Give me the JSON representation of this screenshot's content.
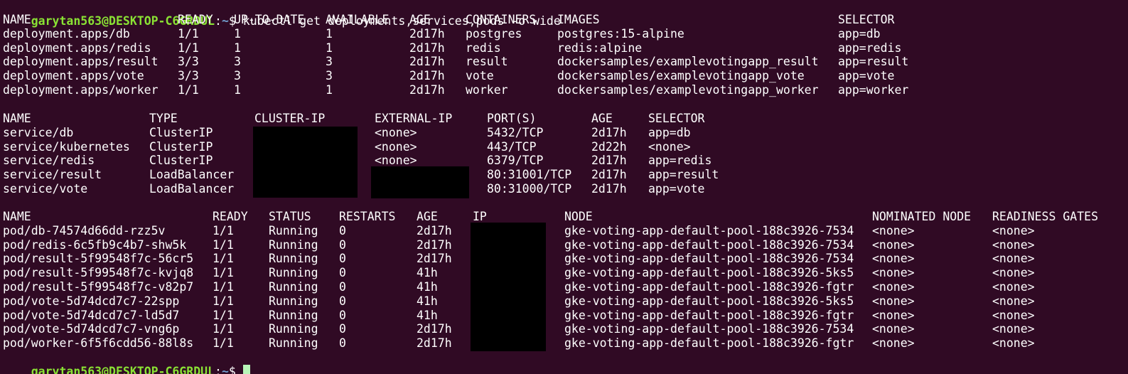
{
  "terminal": {
    "prompt_user": "garytan563@DESKTOP-C6GRDUL",
    "prompt_path": "~",
    "prompt_symbol": "$",
    "command": "kubectl get deployments,services,pods -o wide",
    "colors": {
      "background": "#300a24",
      "text": "#ffffff",
      "prompt_user": "#8ae234",
      "prompt_path": "#729fcf",
      "cursor": "#b8f5b8",
      "redaction": "#000000"
    }
  },
  "deployments": {
    "headers": [
      "NAME",
      "READY",
      "UP-TO-DATE",
      "AVAILABLE",
      "AGE",
      "CONTAINERS",
      "IMAGES",
      "SELECTOR"
    ],
    "rows": [
      [
        "deployment.apps/db",
        "1/1",
        "1",
        "1",
        "2d17h",
        "postgres",
        "postgres:15-alpine",
        "app=db"
      ],
      [
        "deployment.apps/redis",
        "1/1",
        "1",
        "1",
        "2d17h",
        "redis",
        "redis:alpine",
        "app=redis"
      ],
      [
        "deployment.apps/result",
        "3/3",
        "3",
        "3",
        "2d17h",
        "result",
        "dockersamples/examplevotingapp_result",
        "app=result"
      ],
      [
        "deployment.apps/vote",
        "3/3",
        "3",
        "3",
        "2d17h",
        "vote",
        "dockersamples/examplevotingapp_vote",
        "app=vote"
      ],
      [
        "deployment.apps/worker",
        "1/1",
        "1",
        "1",
        "2d17h",
        "worker",
        "dockersamples/examplevotingapp_worker",
        "app=worker"
      ]
    ]
  },
  "services": {
    "headers": [
      "NAME",
      "TYPE",
      "CLUSTER-IP",
      "EXTERNAL-IP",
      "PORT(S)",
      "AGE",
      "SELECTOR"
    ],
    "rows": [
      [
        "service/db",
        "ClusterIP",
        "",
        "<none>",
        "5432/TCP",
        "2d17h",
        "app=db"
      ],
      [
        "service/kubernetes",
        "ClusterIP",
        "",
        "<none>",
        "443/TCP",
        "2d22h",
        "<none>"
      ],
      [
        "service/redis",
        "ClusterIP",
        "",
        "<none>",
        "6379/TCP",
        "2d17h",
        "app=redis"
      ],
      [
        "service/result",
        "LoadBalancer",
        "",
        "",
        "80:31001/TCP",
        "2d17h",
        "app=result"
      ],
      [
        "service/vote",
        "LoadBalancer",
        "",
        "",
        "80:31000/TCP",
        "2d17h",
        "app=vote"
      ]
    ]
  },
  "pods": {
    "headers": [
      "NAME",
      "READY",
      "STATUS",
      "RESTARTS",
      "AGE",
      "IP",
      "NODE",
      "NOMINATED NODE",
      "READINESS GATES"
    ],
    "rows": [
      [
        "pod/db-74574d66dd-rzz5v",
        "1/1",
        "Running",
        "0",
        "2d17h",
        "",
        "gke-voting-app-default-pool-188c3926-7534",
        "<none>",
        "<none>"
      ],
      [
        "pod/redis-6c5fb9c4b7-shw5k",
        "1/1",
        "Running",
        "0",
        "2d17h",
        "",
        "gke-voting-app-default-pool-188c3926-7534",
        "<none>",
        "<none>"
      ],
      [
        "pod/result-5f99548f7c-56cr5",
        "1/1",
        "Running",
        "0",
        "2d17h",
        "",
        "gke-voting-app-default-pool-188c3926-7534",
        "<none>",
        "<none>"
      ],
      [
        "pod/result-5f99548f7c-kvjq8",
        "1/1",
        "Running",
        "0",
        "41h",
        "",
        "gke-voting-app-default-pool-188c3926-5ks5",
        "<none>",
        "<none>"
      ],
      [
        "pod/result-5f99548f7c-v82p7",
        "1/1",
        "Running",
        "0",
        "41h",
        "",
        "gke-voting-app-default-pool-188c3926-fgtr",
        "<none>",
        "<none>"
      ],
      [
        "pod/vote-5d74dcd7c7-22spp",
        "1/1",
        "Running",
        "0",
        "41h",
        "",
        "gke-voting-app-default-pool-188c3926-5ks5",
        "<none>",
        "<none>"
      ],
      [
        "pod/vote-5d74dcd7c7-ld5d7",
        "1/1",
        "Running",
        "0",
        "41h",
        "",
        "gke-voting-app-default-pool-188c3926-fgtr",
        "<none>",
        "<none>"
      ],
      [
        "pod/vote-5d74dcd7c7-vng6p",
        "1/1",
        "Running",
        "0",
        "2d17h",
        "",
        "gke-voting-app-default-pool-188c3926-7534",
        "<none>",
        "<none>"
      ],
      [
        "pod/worker-6f5f6cdd56-88l8s",
        "1/1",
        "Running",
        "0",
        "2d17h",
        "",
        "gke-voting-app-default-pool-188c3926-fgtr",
        "<none>",
        "<none>"
      ]
    ]
  }
}
